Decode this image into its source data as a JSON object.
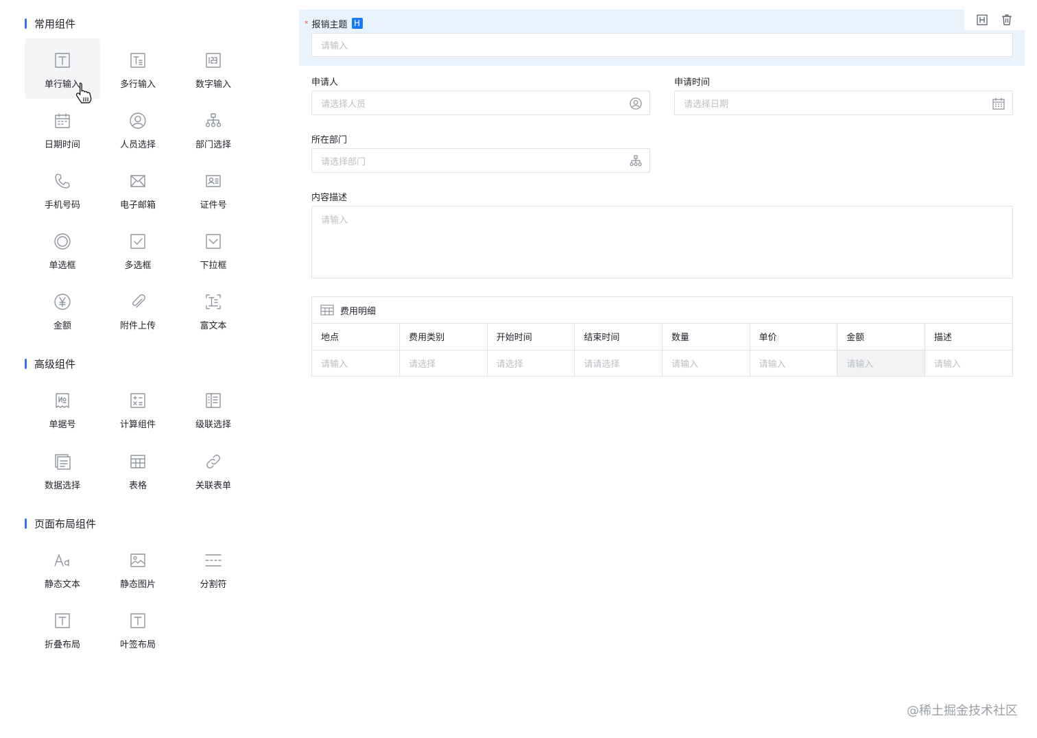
{
  "palette": {
    "sections": [
      {
        "title": "常用组件",
        "items": [
          {
            "label": "单行输入",
            "icon": "text-input-icon"
          },
          {
            "label": "多行输入",
            "icon": "textarea-icon"
          },
          {
            "label": "数字输入",
            "icon": "number-icon"
          },
          {
            "label": "日期时间",
            "icon": "calendar-icon"
          },
          {
            "label": "人员选择",
            "icon": "user-icon"
          },
          {
            "label": "部门选择",
            "icon": "org-icon"
          },
          {
            "label": "手机号码",
            "icon": "phone-icon"
          },
          {
            "label": "电子邮箱",
            "icon": "mail-icon"
          },
          {
            "label": "证件号",
            "icon": "id-card-icon"
          },
          {
            "label": "单选框",
            "icon": "radio-icon"
          },
          {
            "label": "多选框",
            "icon": "checkbox-icon"
          },
          {
            "label": "下拉框",
            "icon": "dropdown-icon"
          },
          {
            "label": "金额",
            "icon": "yen-icon"
          },
          {
            "label": "附件上传",
            "icon": "paperclip-icon"
          },
          {
            "label": "富文本",
            "icon": "rich-text-icon"
          }
        ]
      },
      {
        "title": "高级组件",
        "items": [
          {
            "label": "单据号",
            "icon": "serial-no-icon"
          },
          {
            "label": "计算组件",
            "icon": "calculator-icon"
          },
          {
            "label": "级联选择",
            "icon": "cascader-icon"
          },
          {
            "label": "数据选择",
            "icon": "data-select-icon"
          },
          {
            "label": "表格",
            "icon": "table-icon"
          },
          {
            "label": "关联表单",
            "icon": "link-icon"
          }
        ]
      },
      {
        "title": "页面布局组件",
        "items": [
          {
            "label": "静态文本",
            "icon": "static-text-icon"
          },
          {
            "label": "静态图片",
            "icon": "image-icon"
          },
          {
            "label": "分割符",
            "icon": "divider-icon"
          },
          {
            "label": "折叠布局",
            "icon": "collapse-icon"
          },
          {
            "label": "叶签布局",
            "icon": "tabs-icon"
          }
        ]
      }
    ]
  },
  "form": {
    "subject": {
      "label": "报销主题",
      "required_mark": "*",
      "badge": "H",
      "placeholder": "请输入"
    },
    "applicant": {
      "label": "申请人",
      "placeholder": "请选择人员"
    },
    "apply_time": {
      "label": "申请时间",
      "placeholder": "请选择日期"
    },
    "department": {
      "label": "所在部门",
      "placeholder": "请选择部门"
    },
    "description": {
      "label": "内容描述",
      "placeholder": "请输入"
    },
    "detail_table": {
      "title": "费用明细",
      "columns": [
        "地点",
        "费用类别",
        "开始时间",
        "结束时间",
        "数量",
        "单价",
        "金额",
        "描述"
      ],
      "row": [
        "请输入",
        "请选择",
        "请选择",
        "请请选择",
        "请输入",
        "请输入",
        "请输入",
        "请输入"
      ]
    }
  },
  "watermark": "@稀土掘金技术社区",
  "colors": {
    "accent": "#3370ff",
    "selected_bg": "#e8f3fd",
    "required": "#f54a45",
    "badge": "#1677ff"
  }
}
